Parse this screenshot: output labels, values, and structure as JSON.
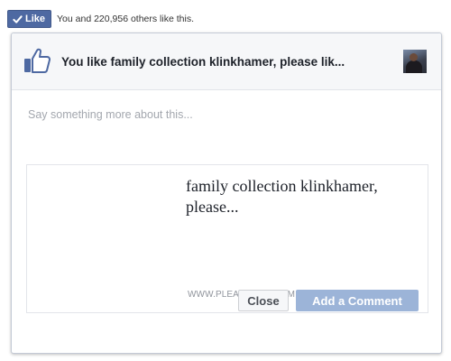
{
  "like_bar": {
    "button_label": "Like",
    "count_text": "You and 220,956 others like this."
  },
  "dialog": {
    "title": "You like family collection klinkhamer, please lik...",
    "comment_placeholder": "Say something more about this...",
    "preview": {
      "title": "family collection klinkhamer, please...",
      "domain": "WWW.PLEASELIKE.COM"
    },
    "buttons": {
      "close": "Close",
      "add_comment": "Add a Comment"
    }
  },
  "icons": {
    "like_check": "check-icon",
    "header": "thumbs-up-icon"
  },
  "colors": {
    "like_button": "#4e69a2",
    "add_comment_button": "#9cb4d8"
  }
}
